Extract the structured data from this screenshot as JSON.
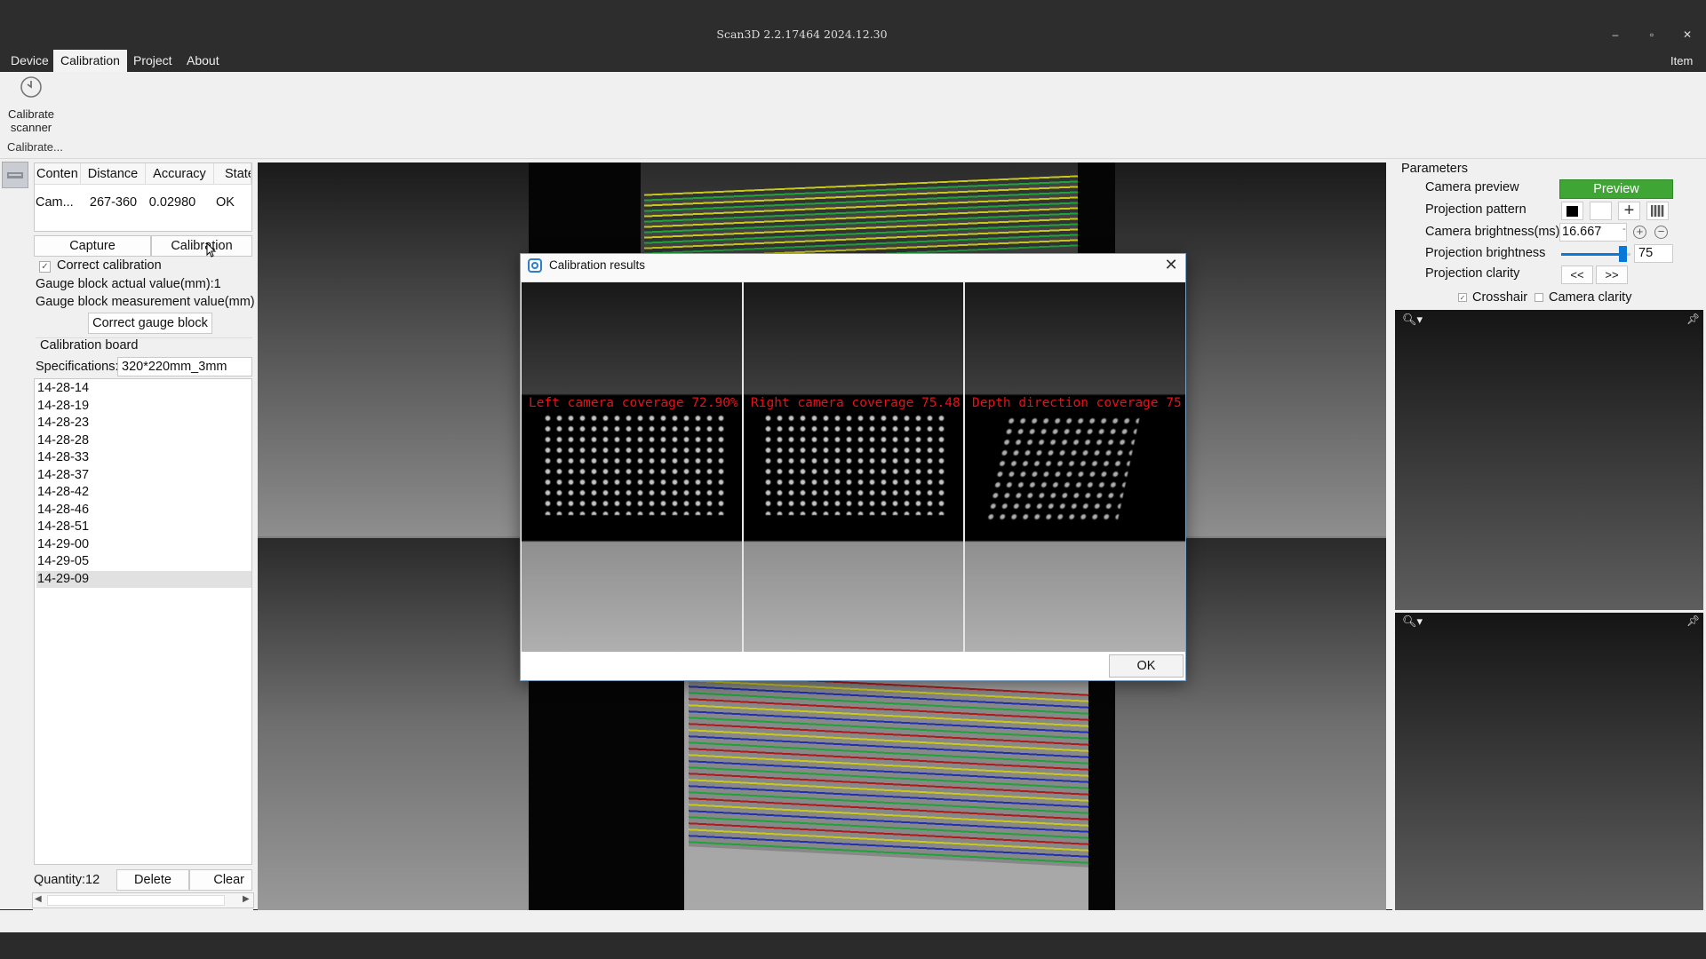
{
  "window": {
    "title": "Scan3D 2.2.17464 2024.12.30",
    "minimize": "–",
    "restore": "▫",
    "close": "✕"
  },
  "menu": {
    "items": [
      "Device",
      "Calibration",
      "Project",
      "About"
    ],
    "right": "Item ▾"
  },
  "ribbon": {
    "button_label": "Calibrate\nscanner",
    "group_label": "Calibrate...",
    "icon": "refresh-icon"
  },
  "table": {
    "headers": [
      "Conten",
      "Distance",
      "Accuracy",
      "State"
    ],
    "rows": [
      [
        "Cam...",
        "267-360",
        "0.02980",
        "OK"
      ]
    ]
  },
  "actions": {
    "capture": "Capture",
    "calibration": "Calibration"
  },
  "correct": {
    "checkbox_label": "Correct calibration",
    "checkbox_checked": true,
    "actual_value": "Gauge block actual value(mm):1",
    "measurement_value": "Gauge block measurement value(mm)",
    "button": "Correct gauge block"
  },
  "board": {
    "title": "Calibration board",
    "spec_label": "Specifications:",
    "spec_value": "320*220mm_3mm"
  },
  "captures": [
    "14-28-14",
    "14-28-19",
    "14-28-23",
    "14-28-28",
    "14-28-33",
    "14-28-37",
    "14-28-42",
    "14-28-46",
    "14-28-51",
    "14-29-00",
    "14-29-05",
    "14-29-09"
  ],
  "selected_capture": "14-29-09",
  "list_footer": {
    "quantity": "Quantity:12",
    "delete": "Delete",
    "clear": "Clear"
  },
  "params": {
    "title": "Parameters",
    "camera_preview_label": "Camera preview",
    "preview_button": "Preview",
    "projection_pattern_label": "Projection pattern",
    "camera_brightness_label": "Camera brightness(ms)",
    "camera_brightness_value": "16.667",
    "projection_brightness_label": "Projection brightness",
    "projection_brightness_value": "75",
    "projection_brightness_fraction": 0.88,
    "projection_clarity_label": "Projection clarity",
    "clarity_prev": "<<",
    "clarity_next": ">>",
    "crosshair_label": "Crosshair",
    "crosshair_checked": true,
    "camera_clarity_label": "Camera clarity",
    "camera_clarity_checked": false,
    "accent": "#3fa535"
  },
  "dialog": {
    "title": "Calibration results",
    "coverages": [
      "Left camera coverage 72.90%",
      "Right camera coverage 75.48",
      "Depth direction coverage 75"
    ],
    "ok": "OK",
    "text_color": "#e8101a"
  }
}
